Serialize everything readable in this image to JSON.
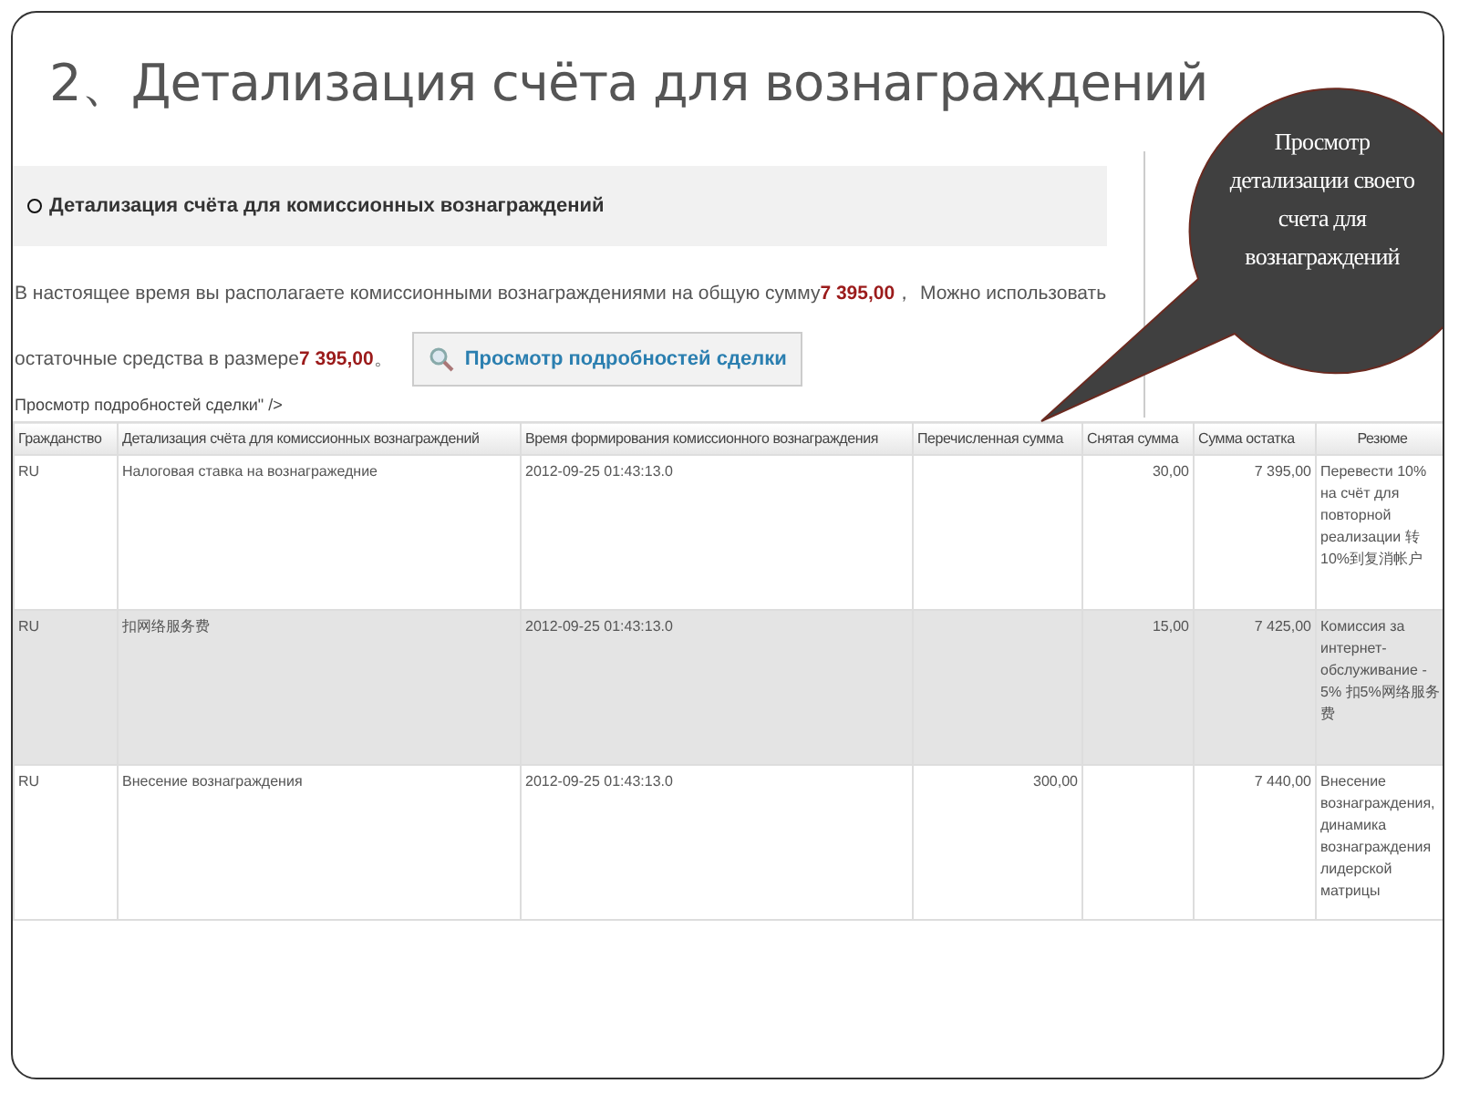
{
  "slide": {
    "title": "2、Детализация счёта для вознаграждений"
  },
  "panel": {
    "heading": "Детализация счёта для комиссионных вознаграждений",
    "message_lines": [
      "В настоящее время вы располагаете комиссионными вознаграждениями на общую сумму**7 395,00**，  Можно использовать",
      "остаточные средства в размере**7 395,00**。"
    ],
    "button": "Просмотр подробностей сделки",
    "stray_text": "Просмотр подробностей сделки\" />"
  },
  "table": {
    "columns": [
      "Гражданство",
      "Детализация счёта для комиссионных вознаграждений",
      "Время формирования комиссионного вознаграждения",
      "Перечисленная сумма",
      "Снятая сумма",
      "Сумма остатка",
      "Резюме"
    ],
    "rows": [
      {
        "cells": [
          "RU",
          "Налоговая ставка на вознагражедние",
          "2012-09-25 01:43:13.0",
          "",
          "30,00",
          "7 395,00",
          "Перевести 10% на счёт для повторной реализации 转10%到复消帐户"
        ],
        "selected": false
      },
      {
        "cells": [
          "RU",
          "扣网络服务费",
          "2012-09-25 01:43:13.0",
          "",
          "15,00",
          "7 425,00",
          "Комиссия за интернет-обслуживание - 5% 扣5%网络服务费"
        ],
        "selected": true
      },
      {
        "cells": [
          "RU",
          "Внесение вознаграждения",
          "2012-09-25 01:43:13.0",
          "300,00",
          "",
          "7 440,00",
          "Внесение вознаграждения, динамика вознаграждения лидерской матрицы"
        ],
        "selected": false
      }
    ]
  },
  "callout": {
    "text": "Просмотр детализации своего счета для вознаграждений"
  }
}
